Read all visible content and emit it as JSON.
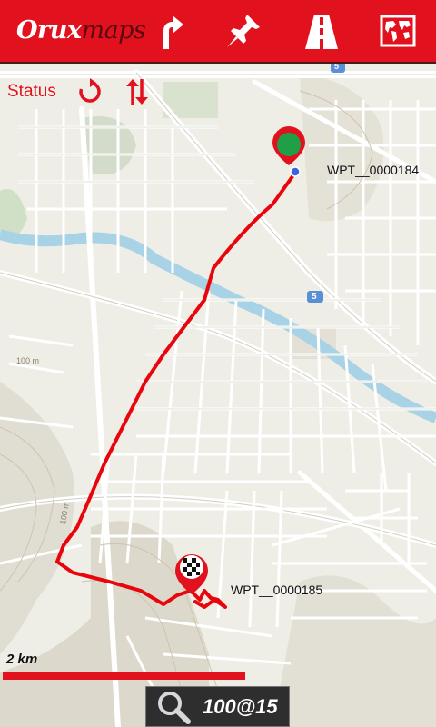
{
  "app": {
    "logo_part1": "Orux",
    "logo_part2": "maps"
  },
  "toolbar": {
    "items": [
      {
        "icon": "turn-arrow-icon"
      },
      {
        "icon": "pushpin-icon"
      },
      {
        "icon": "road-icon"
      },
      {
        "icon": "world-map-icon"
      }
    ]
  },
  "status": {
    "label": "Status",
    "reload_icon": "refresh-icon",
    "swap_icon": "swap-arrows-icon"
  },
  "waypoints": [
    {
      "name": "WPT__0000184",
      "marker": "green-start-pin"
    },
    {
      "name": "WPT__0000185",
      "marker": "checkered-finish-pin"
    }
  ],
  "map_labels": {
    "route_shield_1": "5",
    "route_shield_2": "5",
    "contour_1": "100 m",
    "contour_2": "100 m"
  },
  "scale": {
    "label": "2 km"
  },
  "zoom": {
    "icon": "magnifier-icon",
    "text": "100@15"
  },
  "colors": {
    "brand_red": "#e2111e",
    "track_red": "#e8060c",
    "start_green": "#1fa048",
    "water": "#a8d2e6"
  }
}
